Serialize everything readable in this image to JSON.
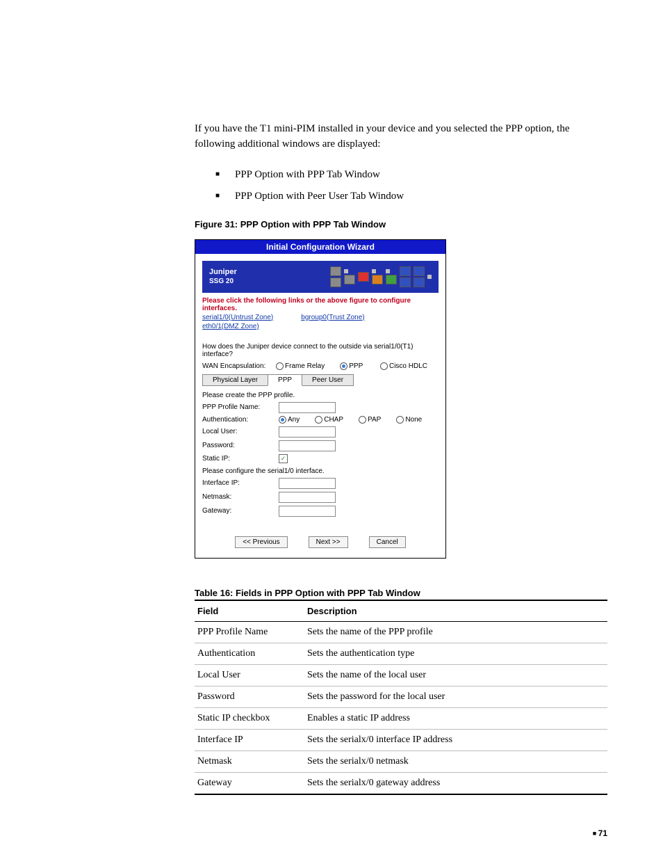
{
  "intro": "If you have the T1 mini-PIM installed in your device and you selected the PPP option, the following additional windows are displayed:",
  "bullets": [
    "PPP Option with PPP Tab Window",
    "PPP Option with Peer User Tab Window"
  ],
  "figure_caption": "Figure 31:  PPP Option with PPP Tab Window",
  "wizard": {
    "title": "Initial Configuration Wizard",
    "brand": "Juniper",
    "model": "SSG 20",
    "instruction": "Please click the following links or the above figure to configure interfaces.",
    "links": {
      "serial": "serial1/0(Untrust Zone)",
      "bgroup": "bgroup0(Trust Zone)",
      "eth": "eth0/1(DMZ Zone)"
    },
    "question": "How does the Juniper device connect to the outside via serial1/0(T1) interface?",
    "encap_label": "WAN Encapsulation:",
    "encap_opts": {
      "frame": "Frame Relay",
      "ppp": "PPP",
      "cisco": "Cisco HDLC"
    },
    "tabs": {
      "phys": "Physical Layer",
      "ppp": "PPP",
      "peer": "Peer User"
    },
    "form": {
      "instr1": "Please create the PPP profile.",
      "profile": "PPP Profile Name:",
      "auth": "Authentication:",
      "auth_opts": {
        "any": "Any",
        "chap": "CHAP",
        "pap": "PAP",
        "none": "None"
      },
      "local_user": "Local User:",
      "password": "Password:",
      "static_ip": "Static IP:",
      "instr2": "Please configure the serial1/0 interface.",
      "iface_ip": "Interface IP:",
      "netmask": "Netmask:",
      "gateway": "Gateway:"
    },
    "buttons": {
      "prev": "<< Previous",
      "next": "Next >>",
      "cancel": "Cancel"
    }
  },
  "table_caption": "Table 16:  Fields in PPP Option with PPP Tab Window",
  "table": {
    "head_field": "Field",
    "head_desc": "Description",
    "rows": [
      {
        "f": "PPP Profile Name",
        "d": "Sets the name of the PPP profile"
      },
      {
        "f": "Authentication",
        "d": "Sets the authentication type"
      },
      {
        "f": "Local User",
        "d": "Sets the name of the local user"
      },
      {
        "f": "Password",
        "d": "Sets the password for the local user"
      },
      {
        "f": "Static IP checkbox",
        "d": "Enables a static IP address"
      },
      {
        "f": "Interface IP",
        "d": "Sets the serialx/0 interface IP address"
      },
      {
        "f": "Netmask",
        "d": "Sets the serialx/0 netmask"
      },
      {
        "f": "Gateway",
        "d": "Sets the serialx/0 gateway address"
      }
    ]
  },
  "page_number": "71"
}
